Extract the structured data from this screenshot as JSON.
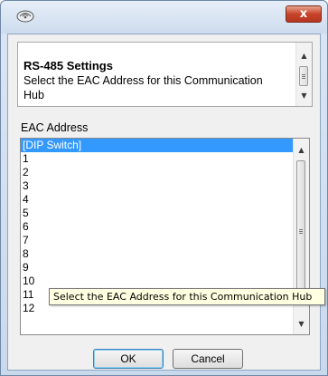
{
  "window": {
    "close_label": "x"
  },
  "description": {
    "title": "RS-485 Settings",
    "text": "Select the EAC Address for this Communication Hub"
  },
  "eac": {
    "label": "EAC Address",
    "items": [
      "[DIP Switch]",
      "1",
      "2",
      "3",
      "4",
      "5",
      "6",
      "7",
      "8",
      "9",
      "10",
      "11",
      "12"
    ],
    "selected_index": 0
  },
  "tooltip": {
    "text": "Select the EAC Address for this Communication Hub"
  },
  "buttons": {
    "ok": "OK",
    "cancel": "Cancel"
  },
  "colors": {
    "selection": "#3399ff",
    "close_button": "#c7442b"
  },
  "icons": {
    "app": "communication-hub-icon",
    "close": "close-icon",
    "scroll_up": "scroll-up-arrow-icon",
    "scroll_down": "scroll-down-arrow-icon"
  }
}
